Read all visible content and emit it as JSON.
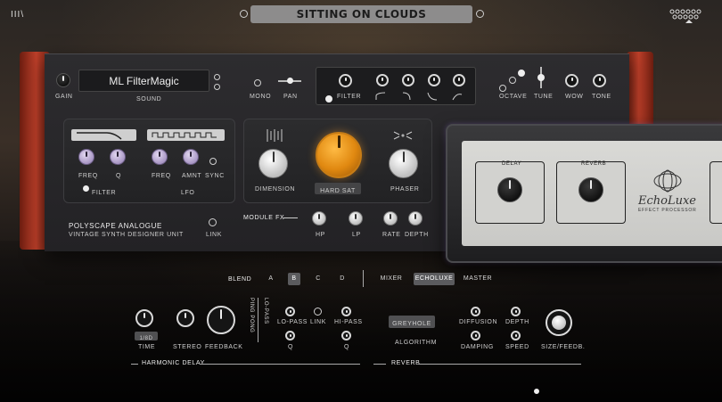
{
  "header": {
    "logo_text": "III\\",
    "preset_name": "SITTING ON CLOUDS"
  },
  "synth": {
    "gain_label": "GAIN",
    "sound_name": "ML FilterMagic",
    "sound_label": "SOUND",
    "mono_label": "MONO",
    "pan_label": "PAN",
    "filter_label": "FILTER",
    "octave_label": "OCTAVE",
    "tune_label": "TUNE",
    "wow_label": "WOW",
    "tone_label": "TONE",
    "filter_section": {
      "freq_label": "FREQ",
      "q_label": "Q",
      "title": "FILTER"
    },
    "lfo_section": {
      "freq_label": "FREQ",
      "amnt_label": "AMNT",
      "sync_label": "SYNC",
      "title": "LFO"
    },
    "brand_line1": "POLYSCAPE ANALOGUE",
    "brand_line2": "VINTAGE SYNTH DESIGNER UNIT",
    "link_label": "LINK",
    "fx": {
      "dimension_label": "DIMENSION",
      "hardsat_label": "HARD SAT",
      "phaser_label": "PHASER",
      "module_fx_label": "MODULE FX",
      "hp_label": "HP",
      "lp_label": "LP",
      "rate_label": "RATE",
      "depth_label": "DEPTH"
    }
  },
  "echo": {
    "delay_label": "DELAY",
    "reverb_label": "REVERB",
    "name": "EchoLuxe",
    "subtitle": "EFFECT PROCESSOR"
  },
  "bottom": {
    "blend_label": "BLEND",
    "blend_options": [
      "A",
      "B",
      "C",
      "D"
    ],
    "blend_selected": "B",
    "tabs": [
      "MIXER",
      "ECHOLUXE",
      "MASTER"
    ],
    "tab_selected": "ECHOLUXE",
    "delay": {
      "time_value": "1/8D",
      "time_label": "TIME",
      "stereo_label": "STEREO",
      "feedback_label": "FEEDBACK",
      "ping_pong_label": "PING PONG",
      "lo_pass_label": "LO-PASS",
      "link_label": "LINK",
      "hi_pass_label": "HI-PASS",
      "q1_label": "Q",
      "q2_label": "Q",
      "section_title": "HARMONIC DELAY"
    },
    "reverb": {
      "algorithm_value": "GREYHOLE",
      "algorithm_label": "ALGORITHM",
      "diffusion_label": "DIFFUSION",
      "depth_label": "DEPTH",
      "damping_label": "DAMPING",
      "speed_label": "SPEED",
      "size_label": "SIZE/FEEDB.",
      "section_title": "REVERB"
    }
  }
}
